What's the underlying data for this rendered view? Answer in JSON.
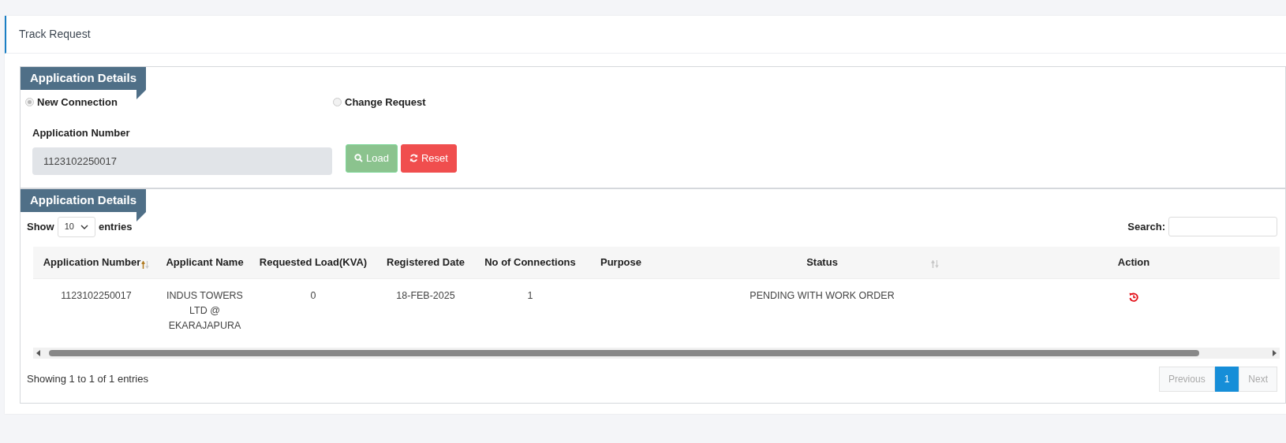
{
  "page_title": "Track Request",
  "form_panel": {
    "title": "Application Details",
    "request_types": [
      {
        "label": "New Connection",
        "selected": true
      },
      {
        "label": "Change Request",
        "selected": false
      }
    ],
    "application_number": {
      "label": "Application Number",
      "value": "1123102250017",
      "disabled": true
    },
    "buttons": [
      {
        "kind": "load",
        "label": "Load"
      },
      {
        "kind": "reset",
        "label": "Reset"
      }
    ]
  },
  "results_panel": {
    "title": "Application Details",
    "length": {
      "before": "Show",
      "value": "10",
      "after": "entries"
    },
    "search": {
      "label": "Search:"
    },
    "table": {
      "columns": [
        {
          "label": "Application Number",
          "sortable": true,
          "sorted": true
        },
        {
          "label": "Applicant Name",
          "sortable": false,
          "sorted": false
        },
        {
          "label": "Requested Load(KVA)",
          "sortable": false,
          "sorted": false
        },
        {
          "label": "Registered Date",
          "sortable": false,
          "sorted": false
        },
        {
          "label": "No of Connections",
          "sortable": false,
          "sorted": false
        },
        {
          "label": "Purpose",
          "sortable": false,
          "sorted": false
        },
        {
          "label": "Status",
          "sortable": true,
          "sorted": false
        },
        {
          "label": "Action",
          "sortable": false,
          "sorted": false
        }
      ],
      "rows": [
        {
          "cells": [
            "1123102250017",
            "INDUS TOWERS LTD @ EKARAJAPURA",
            "0",
            "18-FEB-2025",
            "1",
            "",
            "PENDING WITH WORK ORDER"
          ]
        }
      ]
    },
    "info": "Showing 1 to 1 of 1 entries",
    "pagination": [
      {
        "label": "Previous",
        "disabled": true,
        "selected": false
      },
      {
        "label": "1",
        "disabled": false,
        "selected": true
      },
      {
        "label": "Next",
        "disabled": true,
        "selected": false
      }
    ]
  }
}
